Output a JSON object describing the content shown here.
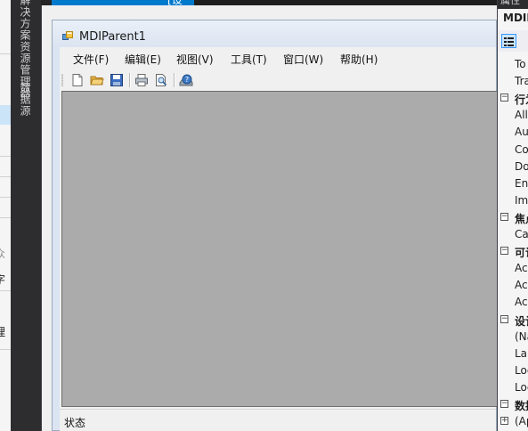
{
  "ide": {
    "top_tab_label": "[设计]",
    "side_tabs": [
      {
        "label": "解决方案资源管理器"
      },
      {
        "label": "数据源"
      }
    ],
    "left_panel_fragments": [
      "众",
      "字",
      "理"
    ]
  },
  "form": {
    "title": "MDIParent1",
    "icon": "form-icon",
    "menu": [
      {
        "label": "文件(F)"
      },
      {
        "label": "编辑(E)"
      },
      {
        "label": "视图(V)"
      },
      {
        "label": "工具(T)"
      },
      {
        "label": "窗口(W)"
      },
      {
        "label": "帮助(H)"
      }
    ],
    "toolbar": [
      {
        "name": "new-file-icon"
      },
      {
        "name": "open-folder-icon"
      },
      {
        "name": "save-icon"
      },
      {
        "name": "print-icon"
      },
      {
        "name": "print-preview-icon"
      },
      {
        "name": "help-icon"
      }
    ],
    "client_color": "#ababab",
    "status_label": "状态"
  },
  "properties": {
    "header": "属性",
    "object_name": "MDIP",
    "rows": [
      {
        "type": "prop",
        "label": "To"
      },
      {
        "type": "prop",
        "label": "Tra"
      },
      {
        "type": "category",
        "label": "行为",
        "expanded": true
      },
      {
        "type": "prop",
        "label": "Allo"
      },
      {
        "type": "prop",
        "label": "Aut"
      },
      {
        "type": "prop",
        "label": "Co"
      },
      {
        "type": "prop",
        "label": "Do"
      },
      {
        "type": "prop",
        "label": "Ena"
      },
      {
        "type": "prop",
        "label": "Ime"
      },
      {
        "type": "category",
        "label": "焦点",
        "expanded": true
      },
      {
        "type": "prop",
        "label": "Ca"
      },
      {
        "type": "category",
        "label": "可访",
        "expanded": true
      },
      {
        "type": "prop",
        "label": "Acc"
      },
      {
        "type": "prop",
        "label": "Acc"
      },
      {
        "type": "prop",
        "label": "Acc"
      },
      {
        "type": "category",
        "label": "设计",
        "expanded": true
      },
      {
        "type": "prop",
        "label": "(Na"
      },
      {
        "type": "prop",
        "label": "Lar"
      },
      {
        "type": "prop",
        "label": "Loc"
      },
      {
        "type": "prop",
        "label": "Loc"
      },
      {
        "type": "category",
        "label": "数据",
        "expanded": true
      },
      {
        "type": "prop",
        "label": "(Ap",
        "collapsed_marker": true
      }
    ]
  }
}
